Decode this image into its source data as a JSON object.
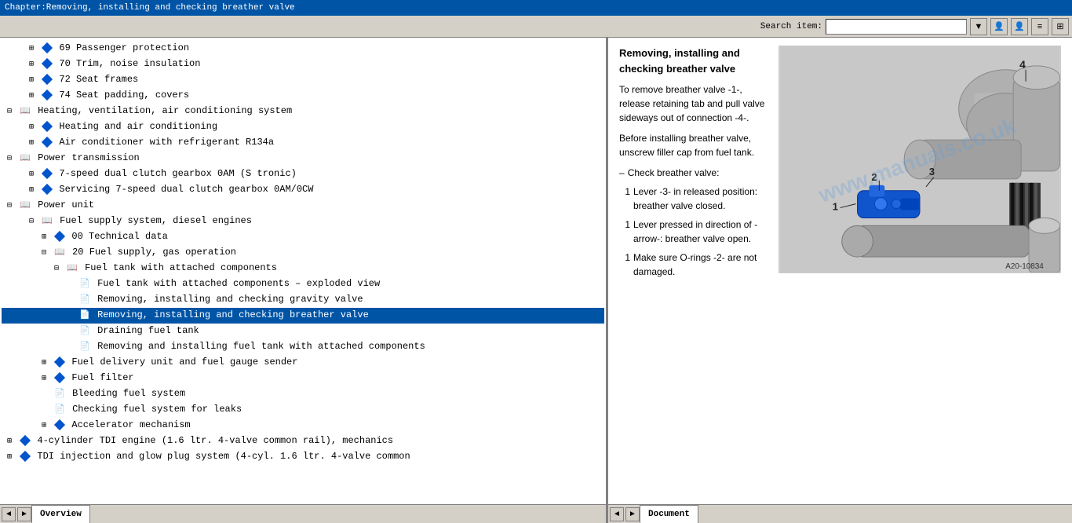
{
  "titlebar": {
    "text": "Chapter:Removing, installing and checking breather valve"
  },
  "toolbar": {
    "search_label": "Search item:",
    "search_placeholder": "",
    "buttons": [
      "user1",
      "user2",
      "menu1",
      "menu2"
    ]
  },
  "tree": {
    "items": [
      {
        "id": 1,
        "level": 2,
        "icon": "diamond",
        "expanded": false,
        "text": "69  Passenger protection"
      },
      {
        "id": 2,
        "level": 2,
        "icon": "diamond",
        "expanded": false,
        "text": "70  Trim, noise insulation"
      },
      {
        "id": 3,
        "level": 2,
        "icon": "diamond",
        "expanded": false,
        "text": "72  Seat frames"
      },
      {
        "id": 4,
        "level": 2,
        "icon": "diamond",
        "expanded": false,
        "text": "74  Seat padding, covers"
      },
      {
        "id": 5,
        "level": 1,
        "icon": "book",
        "expanded": true,
        "text": "Heating, ventilation, air conditioning system"
      },
      {
        "id": 6,
        "level": 2,
        "icon": "diamond",
        "expanded": false,
        "text": "Heating and air conditioning"
      },
      {
        "id": 7,
        "level": 2,
        "icon": "diamond",
        "expanded": false,
        "text": "Air conditioner with refrigerant R134a"
      },
      {
        "id": 8,
        "level": 1,
        "icon": "book",
        "expanded": true,
        "text": "Power transmission"
      },
      {
        "id": 9,
        "level": 2,
        "icon": "diamond",
        "expanded": false,
        "text": "7-speed dual clutch gearbox 0AM (S tronic)"
      },
      {
        "id": 10,
        "level": 2,
        "icon": "diamond",
        "expanded": false,
        "text": "Servicing 7-speed dual clutch gearbox 0AM/0CW"
      },
      {
        "id": 11,
        "level": 1,
        "icon": "book",
        "expanded": true,
        "text": "Power unit"
      },
      {
        "id": 12,
        "level": 2,
        "icon": "book",
        "expanded": true,
        "text": "Fuel supply system, diesel engines"
      },
      {
        "id": 13,
        "level": 3,
        "icon": "diamond",
        "expanded": false,
        "text": "00  Technical data"
      },
      {
        "id": 14,
        "level": 3,
        "icon": "book",
        "expanded": true,
        "text": "20  Fuel supply, gas operation"
      },
      {
        "id": 15,
        "level": 4,
        "icon": "book",
        "expanded": true,
        "text": "Fuel tank with attached components"
      },
      {
        "id": 16,
        "level": 5,
        "icon": "doc",
        "text": "Fuel tank with attached components – exploded view"
      },
      {
        "id": 17,
        "level": 5,
        "icon": "doc",
        "text": "Removing, installing and checking gravity valve"
      },
      {
        "id": 18,
        "level": 5,
        "icon": "doc",
        "text": "Removing, installing and checking breather valve",
        "selected": true
      },
      {
        "id": 19,
        "level": 5,
        "icon": "doc",
        "text": "Draining fuel tank"
      },
      {
        "id": 20,
        "level": 5,
        "icon": "doc",
        "text": "Removing and installing fuel tank with attached components"
      },
      {
        "id": 21,
        "level": 3,
        "icon": "diamond",
        "expanded": false,
        "text": "Fuel delivery unit and fuel gauge sender"
      },
      {
        "id": 22,
        "level": 3,
        "icon": "diamond",
        "expanded": false,
        "text": "Fuel filter"
      },
      {
        "id": 23,
        "level": 3,
        "icon": "doc",
        "text": "Bleeding fuel system"
      },
      {
        "id": 24,
        "level": 3,
        "icon": "doc",
        "text": "Checking fuel system for leaks"
      },
      {
        "id": 25,
        "level": 3,
        "icon": "diamond",
        "expanded": false,
        "text": "Accelerator mechanism"
      },
      {
        "id": 26,
        "level": 1,
        "icon": "diamond",
        "expanded": false,
        "text": "4-cylinder TDI engine (1.6 ltr. 4-valve common rail), mechanics"
      },
      {
        "id": 27,
        "level": 1,
        "icon": "diamond",
        "expanded": false,
        "text": "TDI injection and glow plug system (4-cyl. 1.6 ltr. 4-valve common"
      }
    ]
  },
  "document": {
    "title": "Removing, installing and\nchecking breather valve",
    "paragraphs": [
      {
        "type": "text",
        "content": "To remove breather valve -1-, release retaining tab and pull valve sideways out of connection -4-."
      },
      {
        "type": "text",
        "content": "Before installing breather valve, unscrew filler cap from fuel tank."
      },
      {
        "type": "dash",
        "content": "Check breather valve:"
      },
      {
        "type": "numbered",
        "number": "1",
        "content": "Lever -3- in released position: breather valve closed."
      },
      {
        "type": "numbered",
        "number": "1",
        "content": "Lever pressed in direction of -arrow-: breather valve open."
      },
      {
        "type": "numbered",
        "number": "1",
        "content": "Make sure O-rings -2- are not damaged."
      }
    ],
    "image_label": "A20-10834",
    "watermark": "www.manuals.co.uk"
  },
  "statusbar": {
    "left_tab": "Overview",
    "right_tab": "Document"
  }
}
